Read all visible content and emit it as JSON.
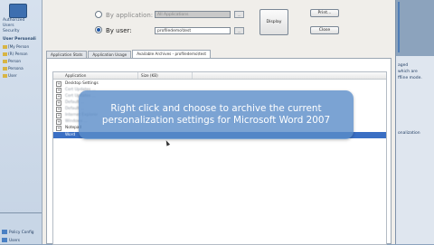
{
  "left_panel": {
    "top_label_1": "Authorized",
    "top_label_2": "Users",
    "top_label_3": "Security",
    "section_title": "User Personali",
    "tree": [
      "[My Person",
      "(R) Person",
      "Person",
      "Persona",
      "User"
    ],
    "bottom": [
      "Policy Config",
      "Users"
    ]
  },
  "dialog": {
    "by_application_label": "By application:",
    "by_application_value": "All Applications",
    "by_user_label": "By user:",
    "by_user_value": "profiledemo\\test",
    "display_button": "Display",
    "print_button": "Print...",
    "close_button": "Close",
    "tabs": [
      "Application Stats",
      "Application Usage",
      "Available Archives - profiledemo\\test"
    ],
    "columns": [
      "Application",
      "Size (KB)"
    ],
    "rows": [
      {
        "label": "Desktop Settings",
        "blurred": false,
        "selected": false
      },
      {
        "label": "Cert Updates ...",
        "blurred": true,
        "selected": false
      },
      {
        "label": "Cert Updates ...",
        "blurred": true,
        "selected": false
      },
      {
        "label": "Default ...",
        "blurred": true,
        "selected": false
      },
      {
        "label": "Default ...",
        "blurred": true,
        "selected": false
      },
      {
        "label": "Internet Explorer",
        "blurred": true,
        "selected": false
      },
      {
        "label": "Windows ...",
        "blurred": true,
        "selected": false
      },
      {
        "label": "Notepad",
        "blurred": false,
        "selected": false
      },
      {
        "label": "Word",
        "blurred": false,
        "selected": true
      }
    ]
  },
  "caption": {
    "text": "Right click and choose to archive the current personalization settings for Microsoft Word 2007"
  },
  "right_panel": {
    "lines": [
      "aged",
      "which are",
      "ffline mode.",
      "onalization"
    ]
  }
}
